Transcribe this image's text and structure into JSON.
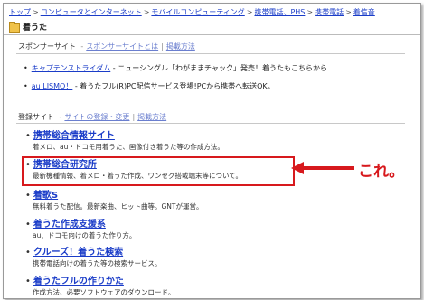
{
  "breadcrumb": {
    "items": [
      "トップ",
      "コンピュータとインターネット",
      "モバイルコンピューティング",
      "携帯電話、PHS",
      "携帯電話",
      "着信音"
    ],
    "separator": ">"
  },
  "page_title": "着うた",
  "sponsor": {
    "heading": "スポンサーサイト",
    "link1": "スポンサーサイトとは",
    "link2": "掲載方法",
    "items": [
      {
        "link": "キャプテンストライダム",
        "text": " - ニューシングル「わがままチャック」発売！着うたもこちらから"
      },
      {
        "link": "au LISMO！",
        "text": " - 着うたフル(R)PC配信サービス登場!PCから携帯へ転送OK。"
      }
    ]
  },
  "registered": {
    "heading": "登録サイト",
    "link1": "サイトの登録・変更",
    "link2": "掲載方法",
    "sites": [
      {
        "name": "携帯総合情報サイト",
        "desc": "着メロ、au・ドコモ用着うた、画像付き着うた等の作成方法。"
      },
      {
        "name": "携帯総合研究所",
        "desc": "最新機種情報、着メロ・着うた作成、ワンセグ搭載端末等について。"
      },
      {
        "name": "着歌S",
        "desc": "無料着うた配信。最新楽曲、ヒット曲等。GNTが運営。"
      },
      {
        "name": "着うた作成支援系",
        "desc": "au、ドコモ向けの着うた作り方。"
      },
      {
        "name": "クルーズ！着うた検索",
        "desc": "携帯電話向けの着うた等の検索サービス。"
      },
      {
        "name": "着うたフルの作りかた",
        "desc": "作成方法、必要ソフトウェアのダウンロード。"
      }
    ]
  },
  "annotation": {
    "text": "これ。",
    "color": "#d7191d"
  }
}
